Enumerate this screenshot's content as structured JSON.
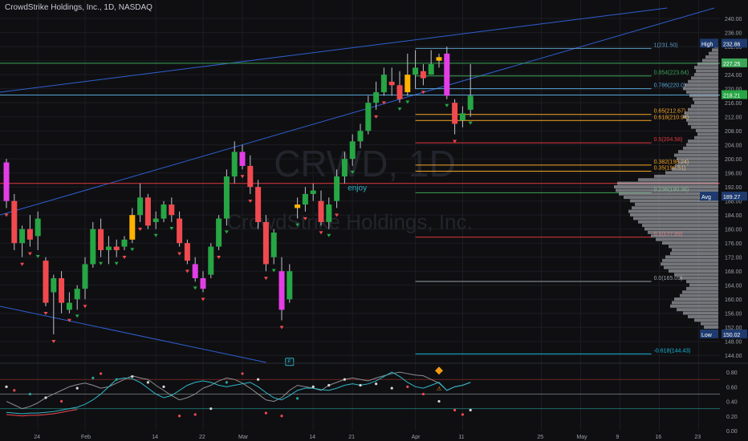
{
  "header": {
    "title": "CrowdStrike Holdings, Inc., 1D, NASDAQ"
  },
  "watermark": {
    "ticker": "CRWD, 1D",
    "name": "CrowdStrike Holdings, Inc."
  },
  "annotations": {
    "enjoy": "enjoy",
    "earnings_marker": "E",
    "warning_marker": "⚠"
  },
  "colors": {
    "background": "#0f0f12",
    "up": "#26a644",
    "down": "#f04a4f",
    "up_alt": "#ffb300",
    "down_alt": "#e33ee6",
    "channel": "#2f5fd1",
    "grid": "#1c1d22"
  },
  "chart_data": [
    {
      "type": "candlestick",
      "title": "CrowdStrike Holdings, Inc., 1D, NASDAQ",
      "ylim": [
        142,
        243
      ],
      "y_ticks": [
        144,
        148,
        152,
        156,
        160,
        164,
        168,
        172,
        176,
        180,
        184,
        188,
        192,
        196,
        200,
        204,
        208,
        212,
        216,
        220,
        224,
        228,
        232,
        236,
        240
      ],
      "x_ticks": [
        {
          "label": "24",
          "day": 4
        },
        {
          "label": "Feb",
          "day": 10
        },
        {
          "label": "14",
          "day": 19
        },
        {
          "label": "22",
          "day": 25
        },
        {
          "label": "Mar",
          "day": 30
        },
        {
          "label": "14",
          "day": 39
        },
        {
          "label": "21",
          "day": 44
        },
        {
          "label": "Apr",
          "day": 52
        },
        {
          "label": "11",
          "day": 58
        },
        {
          "label": "25",
          "day": 68
        },
        {
          "label": "May",
          "day": 73
        },
        {
          "label": "9",
          "day": 78
        },
        {
          "label": "16",
          "day": 83
        },
        {
          "label": "23",
          "day": 88
        }
      ],
      "candles": [
        [
          0,
          199,
          200,
          186,
          188
        ],
        [
          1,
          188,
          190,
          174,
          176
        ],
        [
          2,
          176,
          181,
          172,
          180
        ],
        [
          3,
          180,
          184,
          175,
          177
        ],
        [
          4,
          178,
          185,
          174,
          183
        ],
        [
          5,
          171,
          172,
          158,
          159
        ],
        [
          6,
          162,
          167,
          150,
          166
        ],
        [
          7,
          166,
          168,
          156,
          159
        ],
        [
          8,
          157,
          162,
          156,
          159
        ],
        [
          9,
          160,
          164,
          157,
          163
        ],
        [
          10,
          163,
          172,
          160,
          170
        ],
        [
          11,
          170,
          182,
          169,
          180
        ],
        [
          12,
          180,
          183,
          172,
          174
        ],
        [
          13,
          174,
          178,
          170,
          175
        ],
        [
          14,
          175,
          177,
          172,
          174
        ],
        [
          15,
          175,
          178,
          174,
          177
        ],
        [
          16,
          177,
          186,
          176,
          184
        ],
        [
          17,
          184,
          193,
          182,
          189
        ],
        [
          18,
          189,
          190,
          180,
          181
        ],
        [
          19,
          182,
          185,
          180,
          183
        ],
        [
          20,
          183,
          188,
          182,
          187
        ],
        [
          21,
          187,
          189,
          182,
          184
        ],
        [
          22,
          183,
          185,
          175,
          176
        ],
        [
          23,
          176,
          177,
          170,
          171
        ],
        [
          24,
          170,
          172,
          165,
          166
        ],
        [
          25,
          166,
          168,
          162,
          163
        ],
        [
          26,
          167,
          176,
          166,
          175
        ],
        [
          27,
          175,
          184,
          174,
          183
        ],
        [
          28,
          183,
          197,
          181,
          195
        ],
        [
          29,
          195,
          205,
          193,
          202
        ],
        [
          30,
          202,
          204,
          197,
          198
        ],
        [
          31,
          198,
          201,
          190,
          192
        ],
        [
          32,
          192,
          194,
          180,
          182
        ],
        [
          33,
          182,
          184,
          168,
          170
        ],
        [
          34,
          172,
          180,
          170,
          179
        ],
        [
          35,
          168,
          172,
          154,
          157
        ],
        [
          36,
          160,
          170,
          159,
          168
        ],
        [
          37,
          186,
          189,
          183,
          187
        ],
        [
          38,
          187,
          192,
          185,
          190
        ],
        [
          39,
          190,
          193,
          188,
          191
        ],
        [
          40,
          188,
          191,
          181,
          182
        ],
        [
          41,
          182,
          189,
          180,
          187
        ],
        [
          42,
          188,
          197,
          186,
          195
        ],
        [
          43,
          195,
          202,
          193,
          200
        ],
        [
          44,
          200,
          207,
          198,
          205
        ],
        [
          45,
          205,
          210,
          203,
          208
        ],
        [
          46,
          208,
          218,
          207,
          216
        ],
        [
          47,
          216,
          222,
          214,
          219
        ],
        [
          48,
          219,
          226,
          218,
          224
        ],
        [
          49,
          222,
          226,
          218,
          221
        ],
        [
          50,
          221,
          225,
          216,
          217
        ],
        [
          51,
          219,
          230,
          218,
          224
        ],
        [
          52,
          224,
          231,
          220,
          226
        ],
        [
          53,
          225,
          227,
          221,
          223
        ],
        [
          54,
          224,
          231,
          224,
          227
        ],
        [
          55,
          228,
          230,
          226,
          229
        ],
        [
          56,
          230,
          232,
          217,
          218
        ],
        [
          57,
          216,
          217,
          207,
          210
        ],
        [
          58,
          211,
          215,
          209,
          213
        ],
        [
          59,
          214,
          227,
          212,
          218
        ]
      ],
      "up_alt_days": [
        16,
        37,
        49,
        50,
        51,
        55
      ],
      "down_alt_days": [
        0,
        24,
        25,
        30,
        35,
        56
      ],
      "signal_up_days": [
        4,
        9,
        12,
        14,
        16,
        19,
        21,
        24,
        28,
        34,
        37,
        41,
        44,
        50,
        51,
        56,
        59
      ],
      "signal_down_days": [
        0,
        2,
        3,
        5,
        6,
        8,
        10,
        15,
        17,
        22,
        23,
        25,
        27,
        30,
        31,
        33,
        35,
        38,
        40,
        42,
        47,
        48,
        53,
        57
      ],
      "fib_levels": [
        {
          "label": "1(231.50)",
          "value": 231.5,
          "color": "#5b9cc4"
        },
        {
          "label": "0.854(223.64)",
          "value": 223.64,
          "color": "#3ba655"
        },
        {
          "label": "0.786(220.0)",
          "value": 220.0,
          "color": "#58a6d6"
        },
        {
          "label": "0.65(212.67)",
          "value": 212.67,
          "color": "#f5a623"
        },
        {
          "label": "0.618(210.94)",
          "value": 210.94,
          "color": "#f5a623"
        },
        {
          "label": "0.5(204.58)",
          "value": 204.58,
          "color": "#e0383e"
        },
        {
          "label": "0.382(198.24)",
          "value": 198.24,
          "color": "#f5a623"
        },
        {
          "label": "0.35(196.51)",
          "value": 196.51,
          "color": "#f5a623"
        },
        {
          "label": "0.236(190.36)",
          "value": 190.36,
          "color": "#3ba655"
        },
        {
          "label": "0.1(177.69)",
          "value": 177.69,
          "color": "#e0383e"
        },
        {
          "label": "0.0(165.09)",
          "value": 165.09,
          "color": "#9aa0a6"
        },
        {
          "label": "-0.618(144.43)",
          "value": 144.43,
          "color": "#14b8d9"
        }
      ],
      "horizontal_lines": [
        {
          "value": 227.25,
          "color": "#3ba655"
        },
        {
          "value": 218.21,
          "color": "#58a6d6"
        },
        {
          "value": 193.0,
          "color": "#e0383e"
        }
      ],
      "price_tags": [
        {
          "name": "High",
          "value": 232.86,
          "text": "232.86",
          "bg": "#1e3a6e"
        },
        {
          "name": "",
          "value": 227.25,
          "text": "227.25",
          "bg": "#3ba655"
        },
        {
          "name": "",
          "value": 218.21,
          "text": "218.21",
          "bg": "#26a644"
        },
        {
          "name": "Avg",
          "value": 189.27,
          "text": "189.27",
          "bg": "#1e3a6e"
        },
        {
          "name": "Low",
          "value": 150.02,
          "text": "150.02",
          "bg": "#1e3a6e"
        }
      ],
      "volume_profile": [
        [
          152,
          18
        ],
        [
          153,
          22
        ],
        [
          154,
          30
        ],
        [
          155,
          38
        ],
        [
          156,
          44
        ],
        [
          157,
          52
        ],
        [
          158,
          60
        ],
        [
          159,
          58
        ],
        [
          160,
          55
        ],
        [
          161,
          48
        ],
        [
          162,
          45
        ],
        [
          163,
          40
        ],
        [
          164,
          36
        ],
        [
          165,
          40
        ],
        [
          166,
          48
        ],
        [
          167,
          55
        ],
        [
          168,
          62
        ],
        [
          169,
          68
        ],
        [
          170,
          72
        ],
        [
          171,
          70
        ],
        [
          172,
          66
        ],
        [
          173,
          60
        ],
        [
          174,
          58
        ],
        [
          175,
          62
        ],
        [
          176,
          70
        ],
        [
          177,
          78
        ],
        [
          178,
          84
        ],
        [
          179,
          88
        ],
        [
          180,
          92
        ],
        [
          181,
          95
        ],
        [
          182,
          100
        ],
        [
          183,
          106
        ],
        [
          184,
          110
        ],
        [
          185,
          112
        ],
        [
          186,
          108
        ],
        [
          187,
          104
        ],
        [
          188,
          110
        ],
        [
          189,
          118
        ],
        [
          190,
          124
        ],
        [
          191,
          128
        ],
        [
          192,
          130
        ],
        [
          193,
          126
        ],
        [
          194,
          100
        ],
        [
          195,
          80
        ],
        [
          196,
          66
        ],
        [
          197,
          58
        ],
        [
          198,
          54
        ],
        [
          199,
          50
        ],
        [
          200,
          52
        ],
        [
          201,
          55
        ],
        [
          202,
          50
        ],
        [
          203,
          44
        ],
        [
          204,
          40
        ],
        [
          205,
          38
        ],
        [
          206,
          30
        ],
        [
          207,
          26
        ],
        [
          208,
          28
        ],
        [
          209,
          34
        ],
        [
          210,
          38
        ],
        [
          211,
          40
        ],
        [
          212,
          44
        ],
        [
          213,
          42
        ],
        [
          214,
          38
        ],
        [
          215,
          34
        ],
        [
          216,
          30
        ],
        [
          217,
          32
        ],
        [
          218,
          36
        ],
        [
          219,
          40
        ],
        [
          220,
          44
        ],
        [
          221,
          42
        ],
        [
          222,
          38
        ],
        [
          223,
          34
        ],
        [
          224,
          30
        ],
        [
          225,
          28
        ],
        [
          226,
          30
        ],
        [
          227,
          26
        ],
        [
          228,
          20
        ],
        [
          229,
          16
        ],
        [
          230,
          12
        ],
        [
          231,
          8
        ],
        [
          232,
          5
        ]
      ]
    },
    {
      "type": "line",
      "name": "oscillator",
      "ylim": [
        0,
        0.9
      ],
      "y_ticks": [
        0.0,
        0.2,
        0.4,
        0.6,
        0.8
      ],
      "levels": [
        0.7,
        0.5,
        0.3
      ],
      "series": [
        {
          "values": [
            0.4,
            0.35,
            0.3,
            0.33,
            0.38,
            0.45,
            0.5,
            0.55,
            0.6,
            0.63,
            0.65,
            0.62,
            0.58,
            0.6,
            0.65,
            0.7,
            0.75,
            0.72,
            0.7,
            0.62,
            0.55,
            0.48,
            0.42,
            0.45,
            0.5,
            0.58,
            0.62,
            0.68,
            0.72,
            0.7,
            0.65,
            0.58,
            0.5,
            0.42,
            0.4,
            0.45,
            0.55,
            0.62,
            0.6,
            0.58,
            0.55,
            0.62,
            0.66,
            0.7,
            0.72,
            0.7,
            0.68,
            0.72,
            0.75,
            0.78,
            0.8,
            0.78,
            0.76,
            0.75,
            0.7,
            0.65,
            0.55,
            0.6,
            0.62,
            0.66
          ]
        },
        {
          "values": [
            0.25,
            0.24,
            0.23,
            0.24,
            0.24,
            0.25,
            0.26,
            0.28,
            0.3,
            0.32,
            0.36,
            0.42,
            0.5,
            0.6,
            0.7,
            0.72,
            0.71,
            0.66,
            0.58,
            0.5,
            0.45,
            0.48,
            0.55,
            0.62,
            0.66,
            0.68,
            0.66,
            0.62,
            0.6,
            0.62,
            0.64,
            0.66,
            0.6,
            0.52,
            0.45,
            0.42,
            0.48,
            0.55,
            0.58,
            0.58,
            0.56,
            0.55,
            0.58,
            0.62,
            0.64,
            0.62,
            0.64,
            0.68,
            0.74,
            0.8,
            0.74,
            0.66,
            0.6,
            0.58,
            0.62,
            0.66,
            0.55,
            0.6,
            0.62,
            0.66
          ]
        }
      ],
      "dots": [
        [
          0,
          0.6,
          "#d9d9d9"
        ],
        [
          1,
          0.55,
          "#f04a4f"
        ],
        [
          3,
          0.5,
          "#26a69a"
        ],
        [
          5,
          0.45,
          "#d9d9d9"
        ],
        [
          7,
          0.4,
          "#f04a4f"
        ],
        [
          9,
          0.58,
          "#d9d9d9"
        ],
        [
          11,
          0.72,
          "#26a69a"
        ],
        [
          12,
          0.78,
          "#f04a4f"
        ],
        [
          14,
          0.7,
          "#26a69a"
        ],
        [
          16,
          0.74,
          "#d9d9d9"
        ],
        [
          18,
          0.66,
          "#d9d9d9"
        ],
        [
          20,
          0.6,
          "#d9d9d9"
        ],
        [
          22,
          0.2,
          "#f04a4f"
        ],
        [
          24,
          0.22,
          "#f04a4f"
        ],
        [
          26,
          0.3,
          "#d9d9d9"
        ],
        [
          28,
          0.66,
          "#26a69a"
        ],
        [
          30,
          0.78,
          "#f04a4f"
        ],
        [
          32,
          0.7,
          "#d9d9d9"
        ],
        [
          33,
          0.24,
          "#f04a4f"
        ],
        [
          35,
          0.2,
          "#f04a4f"
        ],
        [
          37,
          0.44,
          "#26a69a"
        ],
        [
          39,
          0.6,
          "#d9d9d9"
        ],
        [
          41,
          0.62,
          "#d9d9d9"
        ],
        [
          43,
          0.7,
          "#d9d9d9"
        ],
        [
          45,
          0.62,
          "#d9d9d9"
        ],
        [
          47,
          0.64,
          "#d9d9d9"
        ],
        [
          49,
          0.58,
          "#d9d9d9"
        ],
        [
          51,
          0.6,
          "#f04a4f"
        ],
        [
          53,
          0.5,
          "#f04a4f"
        ],
        [
          55,
          0.4,
          "#d9d9d9"
        ],
        [
          57,
          0.28,
          "#f04a4f"
        ],
        [
          58,
          0.22,
          "#f04a4f"
        ],
        [
          59,
          0.28,
          "#d9d9d9"
        ]
      ]
    }
  ]
}
